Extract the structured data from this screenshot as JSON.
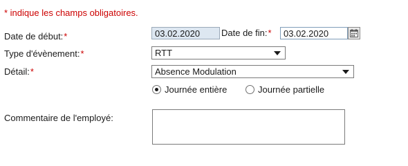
{
  "form": {
    "required_note": "* indique les champs obligatoires.",
    "required_marker": "*",
    "start_date": {
      "label": "Date de début:",
      "value": "03.02.2020"
    },
    "end_date": {
      "label": "Date de fin:",
      "value": "03.02.2020"
    },
    "event_type": {
      "label": "Type d'évènement:",
      "selected": "RTT"
    },
    "detail": {
      "label": "Détail:",
      "selected": "Absence Modulation"
    },
    "duration": {
      "options": [
        {
          "label": "Journée entière",
          "selected": true
        },
        {
          "label": "Journée partielle",
          "selected": false
        }
      ]
    },
    "comment": {
      "label": "Commentaire de l'employé:",
      "value": ""
    }
  },
  "colors": {
    "required": "#cc0000",
    "readonly_field_bg": "#dde7f1"
  },
  "icons": {
    "calendar": "calendar-icon",
    "dropdown": "chevron-down-icon"
  }
}
